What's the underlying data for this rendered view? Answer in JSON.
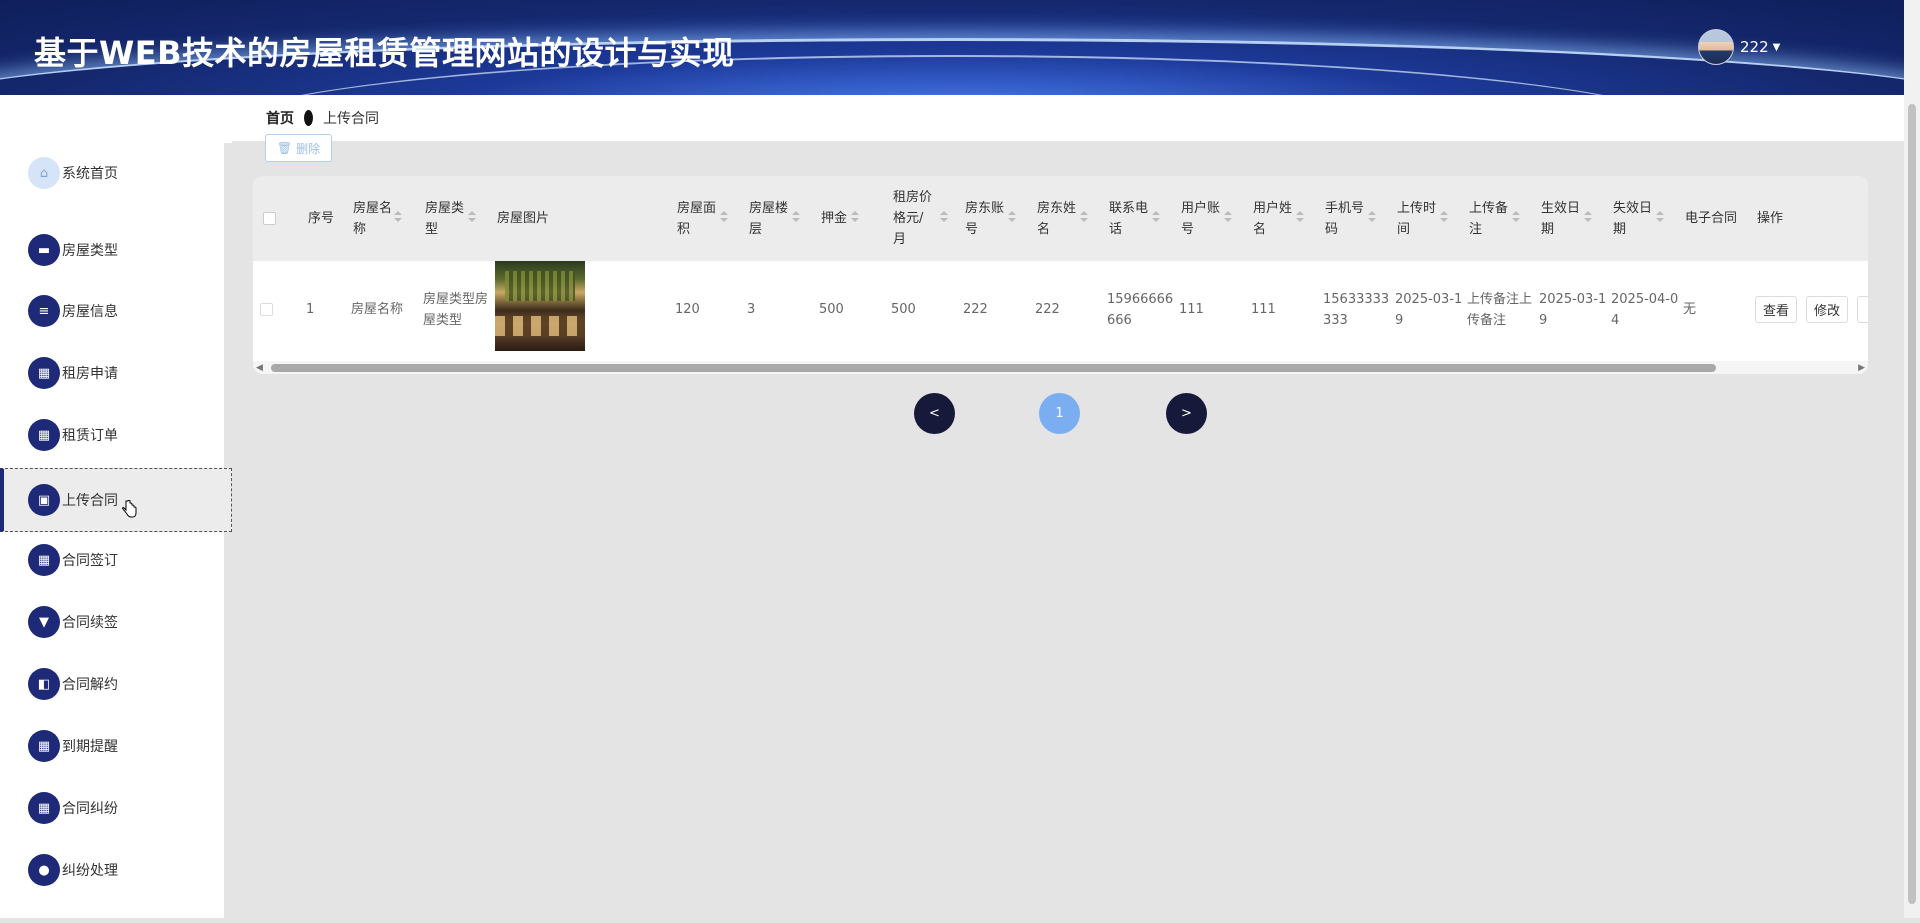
{
  "header": {
    "title": "基于WEB技术的房屋租赁管理网站的设计与实现",
    "username": "222"
  },
  "sidebar": {
    "items": [
      {
        "label": "系统首页",
        "icon": "home-icon"
      },
      {
        "label": "房屋类型",
        "icon": "monitor-icon"
      },
      {
        "label": "房屋信息",
        "icon": "list-icon"
      },
      {
        "label": "租房申请",
        "icon": "grid-icon"
      },
      {
        "label": "租赁订单",
        "icon": "grid-icon"
      },
      {
        "label": "上传合同",
        "icon": "briefcase-icon",
        "active": true
      },
      {
        "label": "合同签订",
        "icon": "grid-icon"
      },
      {
        "label": "合同续签",
        "icon": "brush-icon"
      },
      {
        "label": "合同解约",
        "icon": "house-icon"
      },
      {
        "label": "到期提醒",
        "icon": "grid-icon"
      },
      {
        "label": "合同纠纷",
        "icon": "grid-icon"
      },
      {
        "label": "纠纷处理",
        "icon": "user-icon"
      }
    ]
  },
  "breadcrumb": {
    "home": "首页",
    "current": "上传合同"
  },
  "toolbar": {
    "delete_label": "删除"
  },
  "table": {
    "headers": [
      "序号",
      "房屋名称",
      "房屋类型",
      "房屋图片",
      "房屋面积",
      "房屋楼层",
      "押金",
      "租房价格元/月",
      "房东账号",
      "房东姓名",
      "联系电话",
      "用户账号",
      "用户姓名",
      "手机号码",
      "上传时间",
      "上传备注",
      "生效日期",
      "失效日期",
      "电子合同",
      "操作"
    ],
    "header_lines": {
      "name": [
        "房屋名",
        "称"
      ],
      "type": [
        "房屋类",
        "型"
      ],
      "area": [
        "房屋面",
        "积"
      ],
      "floor": [
        "房屋楼",
        "层"
      ],
      "price": [
        "租房价",
        "格元/",
        "月"
      ],
      "landlord_acc": [
        "房东账",
        "号"
      ],
      "landlord_name": [
        "房东姓",
        "名"
      ],
      "phone": [
        "联系电",
        "话"
      ],
      "user_acc": [
        "用户账",
        "号"
      ],
      "user_name": [
        "用户姓",
        "名"
      ],
      "mobile": [
        "手机号",
        "码"
      ],
      "upload_time": [
        "上传时",
        "间"
      ],
      "upload_note": [
        "上传备",
        "注"
      ],
      "start": [
        "生效日",
        "期"
      ],
      "end": [
        "失效日",
        "期"
      ]
    },
    "row": {
      "index": "1",
      "name": "房屋名称",
      "type_lines": [
        "房屋类型房",
        "屋类型"
      ],
      "area": "120",
      "floor": "3",
      "deposit": "500",
      "price": "500",
      "landlord_acc": "222",
      "landlord_name": "222",
      "phone_lines": [
        "15966666",
        "666"
      ],
      "user_acc": "111",
      "user_name": "111",
      "mobile_lines": [
        "15633333",
        "333"
      ],
      "upload_time_lines": [
        "2025-03-1",
        "9"
      ],
      "upload_note_lines": [
        "上传备注上",
        "传备注"
      ],
      "start_lines": [
        "2025-03-1",
        "9"
      ],
      "end_lines": [
        "2025-04-0",
        "4"
      ],
      "contract": "无",
      "actions": [
        "查看",
        "修改"
      ]
    }
  },
  "pagination": {
    "prev": "<",
    "current": "1",
    "next": ">"
  }
}
